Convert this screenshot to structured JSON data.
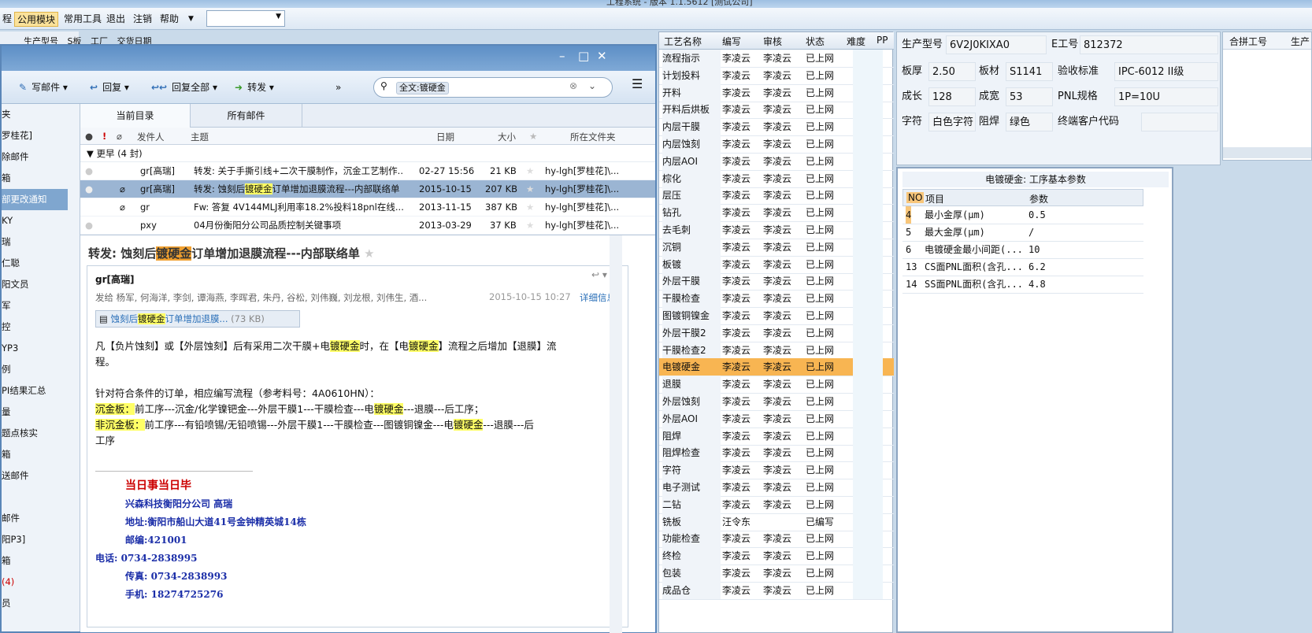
{
  "window": {
    "title": "工程系统 - 版本 1.1.5612 [测试公司]"
  },
  "menu": {
    "items": [
      "程",
      "公用模块",
      "常用工具",
      "退出",
      "注销",
      "帮助"
    ],
    "active": "公用模块"
  },
  "left_header": {
    "col1": "生产型号",
    "col2": "S板",
    "col3": "工厂",
    "col4": "交货日期"
  },
  "left_nav": {
    "items": [
      "夹",
      "罗桂花]",
      "除邮件",
      "箱",
      "部更改通知",
      "KY",
      "瑞",
      "仁聪",
      "阳文员",
      "军",
      "控",
      "YP3",
      "例",
      "PI结果汇总",
      "量",
      "题点核实",
      "箱",
      "送邮件",
      "",
      "邮件",
      "阳P3]",
      "箱",
      "(4)",
      "员"
    ]
  },
  "mail": {
    "toolbar": {
      "compose": "写邮件",
      "reply": "回复",
      "reply_all": "回复全部",
      "forward": "转发",
      "more": "»"
    },
    "search": {
      "query": "全文:镀硬金"
    },
    "tabs": [
      "当前目录",
      "所有邮件"
    ],
    "columns": {
      "sender": "发件人",
      "subject": "主题",
      "date": "日期",
      "size": "大小",
      "folder": "所在文件夹"
    },
    "group": "更早 (4 封)",
    "rows": [
      {
        "sender": "gr[高瑞]",
        "subject": "转发: 关于手撕引线+二次干膜制作，沉金工艺制作...",
        "date": "02-27 15:56",
        "size": "21 KB",
        "folder": "hy-lgh[罗桂花]\\..."
      },
      {
        "sender": "gr[高瑞]",
        "subject_a": "转发: 蚀刻后",
        "subject_hl": "镀硬金",
        "subject_b": "订单增加退膜流程---内部联络单",
        "date": "2015-10-15",
        "size": "207 KB",
        "folder": "hy-lgh[罗桂花]\\..."
      },
      {
        "sender": "gr",
        "subject": "Fw: 答复 4V144MLJ利用率18.2%投料18pnl在线...",
        "date": "2013-11-15",
        "size": "387 KB",
        "folder": "hy-lgh[罗桂花]\\..."
      },
      {
        "sender": "pxy",
        "subject": "04月份衡阳分公司品质控制关键事项",
        "date": "2013-03-29",
        "size": "37 KB",
        "folder": "hy-lgh[罗桂花]\\..."
      }
    ],
    "reading": {
      "subject_a": "转发: 蚀刻后",
      "subject_hl": "镀硬金",
      "subject_b": "订单增加退膜流程---内部联络单",
      "from": "gr[高瑞]",
      "to": "发给 杨军, 何海洋, 李剑, 谭海燕, 李晖君, 朱丹, 谷松, 刘伟巍, 刘龙根, 刘伟生, 酒...",
      "date": "2015-10-15 10:27",
      "detail": "详细信息",
      "attachment": {
        "a": "蚀刻后",
        "hl": "镀硬金",
        "b": "订单增加退膜...",
        "size": "(73 KB)"
      },
      "body": {
        "p1a": "凡【负片蚀刻】或【外层蚀刻】后有采用二次干膜+电",
        "p1hl": "镀硬金",
        "p1b": "时，在【电",
        "p1hl2": "镀硬金",
        "p1c": "】流程之后增加【退膜】流",
        "p1d": "程。",
        "p2": "针对符合条件的订单，相应编写流程（参考料号：4A0610HN）：",
        "p3label": "沉金板：",
        "p3a": "前工序---沉金/化学镍钯金---外层干膜1---干膜检查---电",
        "p3hl": "镀硬金",
        "p3b": "---退膜---后工序；",
        "p4label": "非沉金板：",
        "p4a": "前工序---有铅喷锡/无铅喷锡---外层干膜1---干膜检查---图镀铜镍金---电",
        "p4hl": "镀硬金",
        "p4b": "---退膜---后",
        "p4c": "工序"
      },
      "signature": [
        "当日事当日毕",
        "兴森科技衡阳分公司    高瑞",
        "地址:衡阳市船山大道41号金钟精英城14栋",
        "邮编:421001",
        "电话: 0734-2838995",
        "传真: 0734-2838993",
        "手机: 18274725276"
      ]
    }
  },
  "process": {
    "columns": [
      "工艺名称",
      "编写",
      "审核",
      "状态",
      "难度",
      "PP"
    ],
    "rows": [
      [
        "流程指示",
        "李凌云",
        "李凌云",
        "已上网"
      ],
      [
        "计划投料",
        "李凌云",
        "李凌云",
        "已上网"
      ],
      [
        "开料",
        "李凌云",
        "李凌云",
        "已上网"
      ],
      [
        "开料后烘板",
        "李凌云",
        "李凌云",
        "已上网"
      ],
      [
        "内层干膜",
        "李凌云",
        "李凌云",
        "已上网"
      ],
      [
        "内层蚀刻",
        "李凌云",
        "李凌云",
        "已上网"
      ],
      [
        "内层AOI",
        "李凌云",
        "李凌云",
        "已上网"
      ],
      [
        "棕化",
        "李凌云",
        "李凌云",
        "已上网"
      ],
      [
        "层压",
        "李凌云",
        "李凌云",
        "已上网"
      ],
      [
        "钻孔",
        "李凌云",
        "李凌云",
        "已上网"
      ],
      [
        "去毛刺",
        "李凌云",
        "李凌云",
        "已上网"
      ],
      [
        "沉铜",
        "李凌云",
        "李凌云",
        "已上网"
      ],
      [
        "板镀",
        "李凌云",
        "李凌云",
        "已上网"
      ],
      [
        "外层干膜",
        "李凌云",
        "李凌云",
        "已上网"
      ],
      [
        "干膜检查",
        "李凌云",
        "李凌云",
        "已上网"
      ],
      [
        "图镀铜镍金",
        "李凌云",
        "李凌云",
        "已上网"
      ],
      [
        "外层干膜2",
        "李凌云",
        "李凌云",
        "已上网"
      ],
      [
        "干膜检查2",
        "李凌云",
        "李凌云",
        "已上网"
      ],
      [
        "电镀硬金",
        "李凌云",
        "李凌云",
        "已上网"
      ],
      [
        "退膜",
        "李凌云",
        "李凌云",
        "已上网"
      ],
      [
        "外层蚀刻",
        "李凌云",
        "李凌云",
        "已上网"
      ],
      [
        "外层AOI",
        "李凌云",
        "李凌云",
        "已上网"
      ],
      [
        "阻焊",
        "李凌云",
        "李凌云",
        "已上网"
      ],
      [
        "阻焊检查",
        "李凌云",
        "李凌云",
        "已上网"
      ],
      [
        "字符",
        "李凌云",
        "李凌云",
        "已上网"
      ],
      [
        "电子测试",
        "李凌云",
        "李凌云",
        "已上网"
      ],
      [
        "二钻",
        "李凌云",
        "李凌云",
        "已上网"
      ],
      [
        "铣板",
        "汪令东",
        "",
        "已编写"
      ],
      [
        "功能检查",
        "李凌云",
        "李凌云",
        "已上网"
      ],
      [
        "终检",
        "李凌云",
        "李凌云",
        "已上网"
      ],
      [
        "包装",
        "李凌云",
        "李凌云",
        "已上网"
      ],
      [
        "成品仓",
        "李凌云",
        "李凌云",
        "已上网"
      ]
    ],
    "selected": "电镀硬金"
  },
  "info": {
    "model_label": "生产型号",
    "model": "6V2J0KIXA0",
    "eno_label": "E工号",
    "eno": "812372",
    "thick_label": "板厚",
    "thick": "2.50",
    "mat_label": "板材",
    "mat": "S1141",
    "std_label": "验收标准",
    "std": "IPC-6012 II级",
    "len_label": "成长",
    "len": "128",
    "wid_label": "成宽",
    "wid": "53",
    "pnl_label": "PNL规格",
    "pnl": "1P=10U",
    "char_label": "字符",
    "char": "白色字符",
    "mask_label": "阻焊",
    "mask": "绿色",
    "cust_label": "终端客户代码",
    "cust": ""
  },
  "hebin": {
    "col1": "合拼工号",
    "col2": "生产"
  },
  "params": {
    "title": "电镀硬金: 工序基本参数",
    "columns": [
      "NO",
      "项目",
      "参数"
    ],
    "rows": [
      [
        "4",
        "最小金厚(μm)",
        "0.5"
      ],
      [
        "5",
        "最大金厚(μm)",
        "/"
      ],
      [
        "6",
        "电镀硬金最小间距(...",
        "10"
      ],
      [
        "13",
        "CS面PNL面积(含孔...",
        "6.2"
      ],
      [
        "14",
        "SS面PNL面积(含孔...",
        "4.8"
      ]
    ]
  }
}
